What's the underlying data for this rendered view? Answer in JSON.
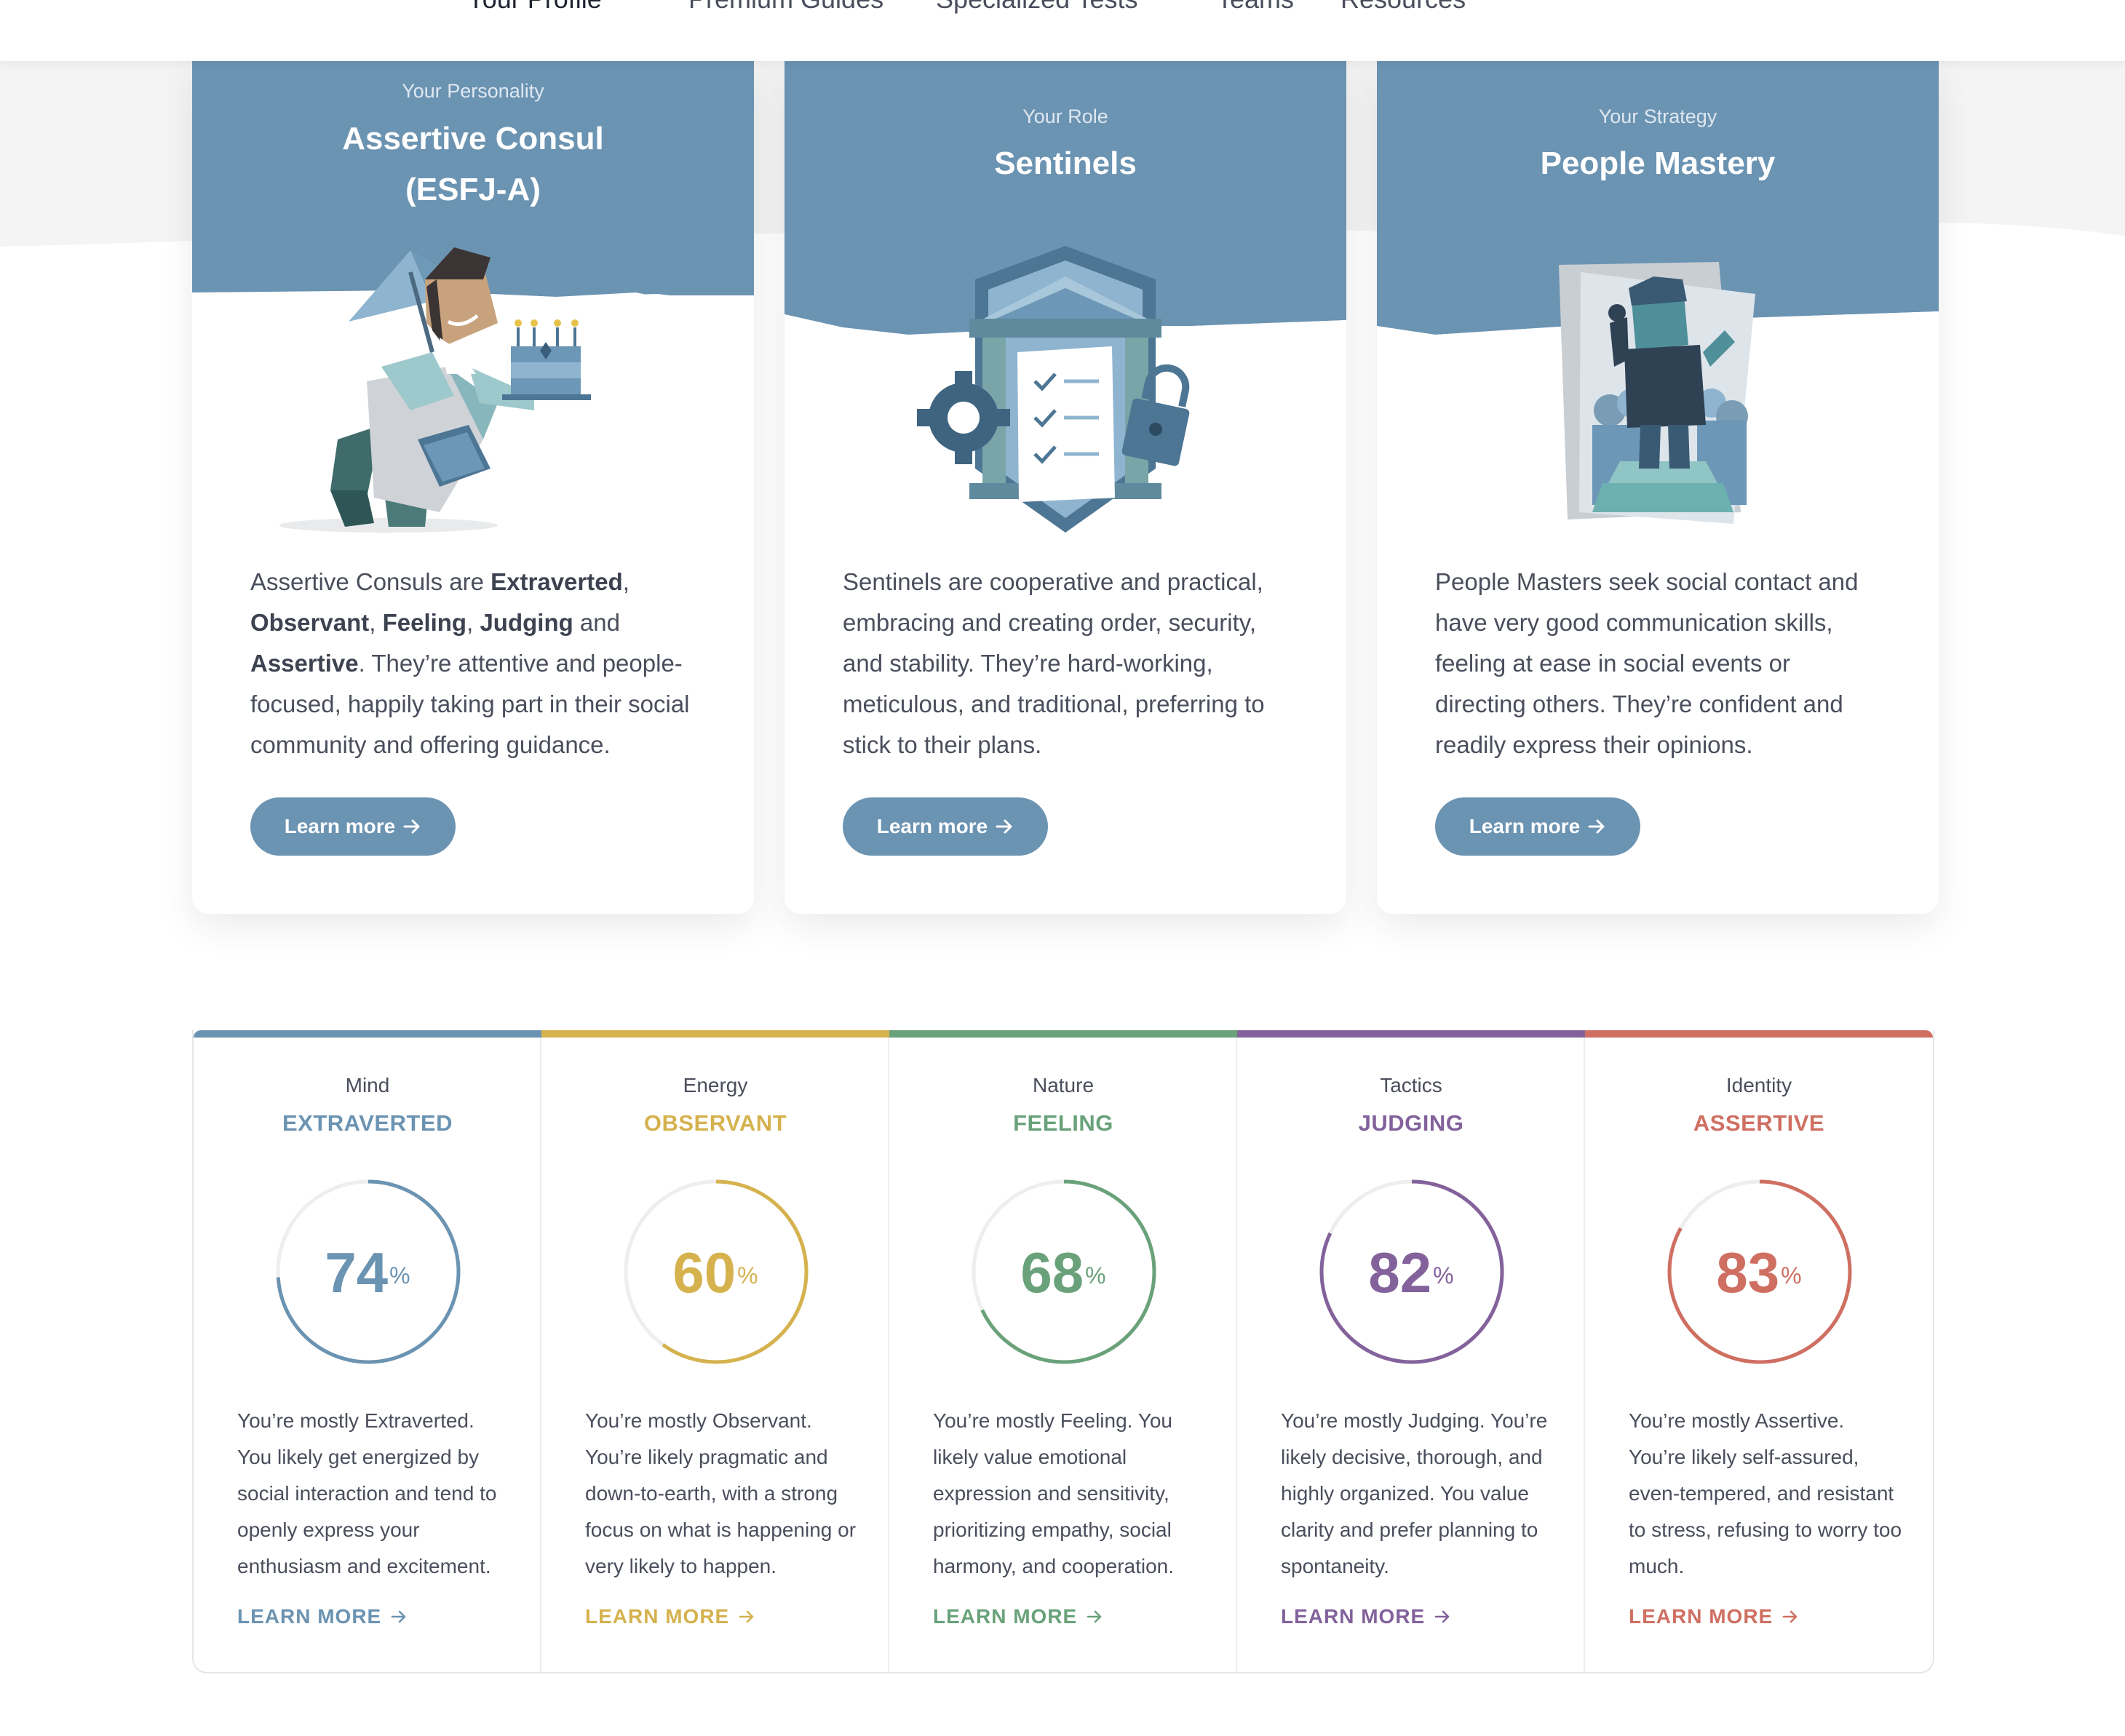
{
  "nav": {
    "items": [
      "Your Profile",
      "Premium Guides",
      "Specialized Tests",
      "Teams",
      "Resources"
    ]
  },
  "cards": [
    {
      "kicker": "Your Personality",
      "title_line1": "Assertive Consul",
      "title_line2": "(ESFJ-A)",
      "desc_parts": [
        "Assertive Consuls are ",
        "Extraverted",
        ", ",
        "Observant",
        ", ",
        "Feeling",
        ", ",
        "Judging",
        " and ",
        "Assertive",
        ". They’re attentive and people-focused, happily taking part in their social community and offering guidance."
      ],
      "button": "Learn more",
      "illustration": "consul-waiter-with-cake-illustration"
    },
    {
      "kicker": "Your Role",
      "title": "Sentinels",
      "desc": "Sentinels are cooperative and practical, embracing and creating order, security, and stability. They’re hard-working, meticulous, and traditional, preferring to stick to their plans.",
      "button": "Learn more",
      "illustration": "sentinel-shield-illustration"
    },
    {
      "kicker": "Your Strategy",
      "title": "People Mastery",
      "desc": "People Masters seek social contact and have very good communication skills, feeling at ease in social events or directing others. They’re confident and readily express their opinions.",
      "button": "Learn more",
      "illustration": "speaker-on-podium-illustration"
    }
  ],
  "traits": [
    {
      "category": "Mind",
      "name": "EXTRAVERTED",
      "percent": 74,
      "percent_suffix": "%",
      "color": "#6b93b2",
      "desc": "You’re mostly Extraverted. You likely get energized by social interaction and tend to openly express your enthusiasm and excitement.",
      "link": "LEARN MORE"
    },
    {
      "category": "Energy",
      "name": "OBSERVANT",
      "percent": 60,
      "percent_suffix": "%",
      "color": "#d5b24e",
      "desc": "You’re mostly Observant. You’re likely pragmatic and down-to-earth, with a strong focus on what is happening or very likely to happen.",
      "link": "LEARN MORE"
    },
    {
      "category": "Nature",
      "name": "FEELING",
      "percent": 68,
      "percent_suffix": "%",
      "color": "#69a27a",
      "desc": "You’re mostly Feeling. You likely value emotional expression and sensitivity, prioritizing empathy, social harmony, and cooperation.",
      "link": "LEARN MORE"
    },
    {
      "category": "Tactics",
      "name": "JUDGING",
      "percent": 82,
      "percent_suffix": "%",
      "color": "#83629c",
      "desc": "You’re mostly Judging. You’re likely decisive, thorough, and highly organized. You value clarity and prefer planning to spontaneity.",
      "link": "LEARN MORE"
    },
    {
      "category": "Identity",
      "name": "ASSERTIVE",
      "percent": 83,
      "percent_suffix": "%",
      "color": "#cf6f62",
      "desc": "You’re mostly Assertive. You’re likely self-assured, even-tempered, and resistant to stress, refusing to worry too much.",
      "link": "LEARN MORE"
    }
  ],
  "colors": {
    "header_blue": "#6b93b2",
    "ring_track": "#eeeeee"
  }
}
